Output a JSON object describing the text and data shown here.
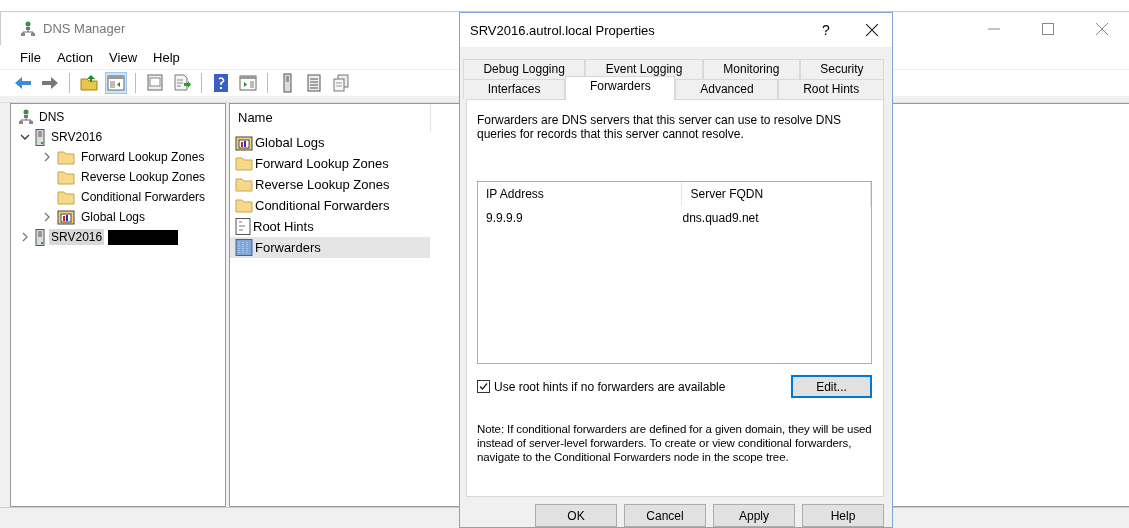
{
  "window": {
    "title": "DNS Manager"
  },
  "menu": [
    {
      "label": "File"
    },
    {
      "label": "Action"
    },
    {
      "label": "View"
    },
    {
      "label": "Help"
    }
  ],
  "toolbar": [
    {
      "kind": "back",
      "pressed": false
    },
    {
      "kind": "forward",
      "pressed": false
    },
    {
      "kind": "separator"
    },
    {
      "kind": "up",
      "pressed": false
    },
    {
      "kind": "console-tree",
      "pressed": true
    },
    {
      "kind": "separator"
    },
    {
      "kind": "properties",
      "pressed": false
    },
    {
      "kind": "export",
      "pressed": false
    },
    {
      "kind": "separator"
    },
    {
      "kind": "help",
      "pressed": false
    },
    {
      "kind": "action-pane",
      "pressed": false
    },
    {
      "kind": "separator"
    },
    {
      "kind": "server",
      "pressed": false
    },
    {
      "kind": "list",
      "pressed": false
    },
    {
      "kind": "copy",
      "pressed": false
    }
  ],
  "tree": [
    {
      "label": "DNS",
      "kind": "dns",
      "selected": false,
      "children": [
        {
          "label": "SRV2016",
          "kind": "server",
          "selected": false,
          "expanded": true,
          "children": [
            {
              "label": "Forward Lookup Zones",
              "kind": "folder",
              "selected": false,
              "expanded": false
            },
            {
              "label": "Reverse Lookup Zones",
              "kind": "folder",
              "selected": false
            },
            {
              "label": "Conditional Forwarders",
              "kind": "folder",
              "selected": false
            },
            {
              "label": "Global Logs",
              "kind": "log",
              "selected": false,
              "expanded": false
            }
          ]
        },
        {
          "label": "SRV2016",
          "kind": "server",
          "selected": true,
          "expanded": false,
          "redacted": true
        }
      ]
    }
  ],
  "list": {
    "columns": [
      "Name"
    ],
    "items": [
      {
        "label": "Global Logs",
        "kind": "log",
        "selected": false
      },
      {
        "label": "Forward Lookup Zones",
        "kind": "folder",
        "selected": false
      },
      {
        "label": "Reverse Lookup Zones",
        "kind": "folder",
        "selected": false
      },
      {
        "label": "Conditional Forwarders",
        "kind": "folder",
        "selected": false
      },
      {
        "label": "Root Hints",
        "kind": "hints",
        "selected": false
      },
      {
        "label": "Forwarders",
        "kind": "forwarders",
        "selected": true
      }
    ]
  },
  "dialog": {
    "title": "SRV2016.autrol.local Properties",
    "help": "?",
    "tabs": [
      [
        {
          "label": "Debug Logging",
          "selected": false
        },
        {
          "label": "Event Logging",
          "selected": false
        },
        {
          "label": "Monitoring",
          "selected": false
        },
        {
          "label": "Security",
          "selected": false
        }
      ],
      [
        {
          "label": "Interfaces",
          "selected": false
        },
        {
          "label": "Forwarders",
          "selected": true
        },
        {
          "label": "Advanced",
          "selected": false
        },
        {
          "label": "Root Hints",
          "selected": false
        }
      ]
    ],
    "description": "Forwarders are DNS servers that this server can use to resolve DNS queries for records that this server cannot resolve.",
    "forwarders": {
      "columns": [
        "IP Address",
        "Server FQDN"
      ],
      "rows": [
        [
          "9.9.9.9",
          "dns.quad9.net"
        ]
      ]
    },
    "use_root_hints": {
      "label": "Use root hints if no forwarders are available",
      "checked": true
    },
    "edit_button": {
      "label": "Edit...",
      "focused": true
    },
    "note": "Note: If conditional forwarders are defined for a given domain, they will be used instead of server-level forwarders.  To create or view conditional forwarders, navigate to the Conditional Forwarders node in the scope tree.",
    "buttons": [
      {
        "label": "OK"
      },
      {
        "label": "Cancel"
      },
      {
        "label": "Apply"
      },
      {
        "label": "Help"
      }
    ]
  }
}
